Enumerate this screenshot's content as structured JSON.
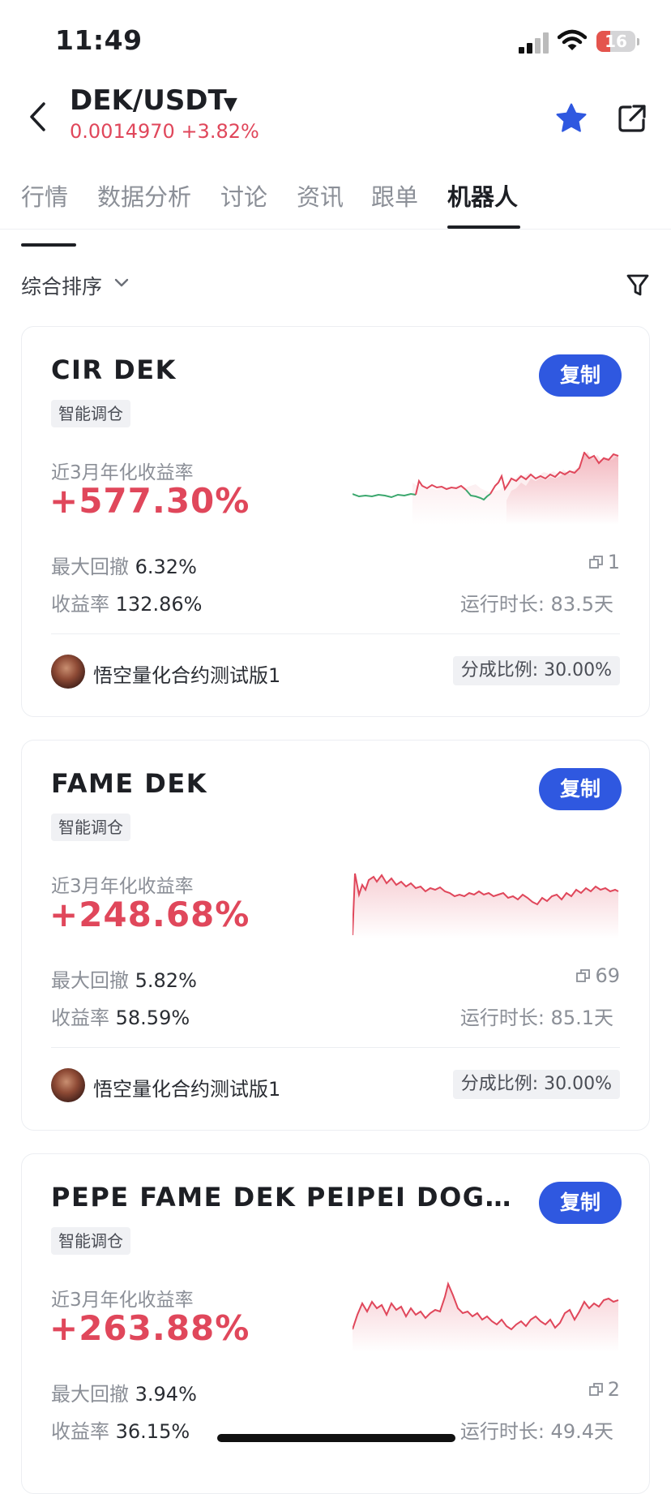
{
  "status_bar": {
    "time": "11:49",
    "battery": "16"
  },
  "header": {
    "pair": "DEK/USDT",
    "price": "0.0014970",
    "change": "+3.82%"
  },
  "tabs": [
    {
      "label": "行情"
    },
    {
      "label": "数据分析"
    },
    {
      "label": "讨论"
    },
    {
      "label": "资讯"
    },
    {
      "label": "跟单"
    },
    {
      "label": "机器人",
      "active": true
    }
  ],
  "sort": {
    "label": "综合排序"
  },
  "colors": {
    "up": "#e0475b",
    "down": "#3aa76d",
    "accent": "#2f58e0"
  },
  "cards": [
    {
      "title": "CIR DEK",
      "copy_label": "复制",
      "tag": "智能调仓",
      "metric_label": "近3月年化收益率",
      "metric_value": "+577.30%",
      "drawdown_label": "最大回撤",
      "drawdown_value": "6.32%",
      "copiers": "1",
      "return_label": "收益率",
      "return_value": "132.86%",
      "runtime": "运行时长: 83.5天",
      "owner": "悟空量化合约测试版1",
      "share_ratio": "分成比例: 30.00%"
    },
    {
      "title": "FAME DEK",
      "copy_label": "复制",
      "tag": "智能调仓",
      "metric_label": "近3月年化收益率",
      "metric_value": "+248.68%",
      "drawdown_label": "最大回撤",
      "drawdown_value": "5.82%",
      "copiers": "69",
      "return_label": "收益率",
      "return_value": "58.59%",
      "runtime": "运行时长: 85.1天",
      "owner": "悟空量化合约测试版1",
      "share_ratio": "分成比例: 30.00%"
    },
    {
      "title": "PEPE FAME DEK PEIPEI DOG W...",
      "copy_label": "复制",
      "tag": "智能调仓",
      "metric_label": "近3月年化收益率",
      "metric_value": "+263.88%",
      "drawdown_label": "最大回撤",
      "drawdown_value": "3.94%",
      "copiers": "2",
      "return_label": "收益率",
      "return_value": "36.15%",
      "runtime": "运行时长: 49.4天"
    }
  ]
}
